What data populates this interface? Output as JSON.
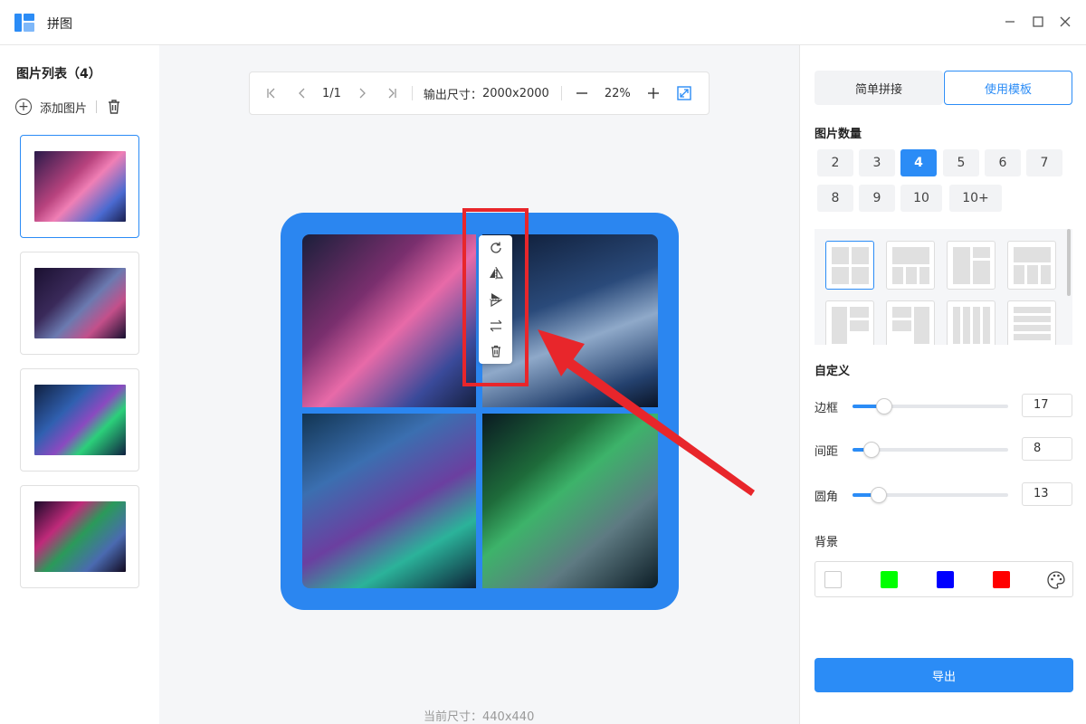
{
  "app": {
    "title": "拼图",
    "logo_icon": "app-logo-icon",
    "window_controls": [
      "minimize-icon",
      "maximize-icon",
      "close-icon"
    ]
  },
  "left_panel": {
    "title": "图片列表（4）",
    "add_label": "添加图片",
    "thumbnails": [
      {
        "name": "thumbnail-1",
        "selected": true
      },
      {
        "name": "thumbnail-2",
        "selected": false
      },
      {
        "name": "thumbnail-3",
        "selected": false
      },
      {
        "name": "thumbnail-4",
        "selected": false
      }
    ]
  },
  "toolbar": {
    "page": "1/1",
    "output_label": "输出尺寸：",
    "output_size": "2000x2000",
    "zoom": "22%"
  },
  "canvas": {
    "current_size_label": "当前尺寸：",
    "current_size": "440x440",
    "collage_color": "#2b86f0",
    "context_menu": [
      "rotate-icon",
      "flip-horizontal-icon",
      "flip-vertical-icon",
      "swap-icon",
      "delete-icon"
    ],
    "highlight_color": "#e8262b"
  },
  "right_panel": {
    "tabs": [
      {
        "label": "简单拼接",
        "active": false
      },
      {
        "label": "使用模板",
        "active": true
      }
    ],
    "count_title": "图片数量",
    "counts": [
      "2",
      "3",
      "4",
      "5",
      "6",
      "7",
      "8",
      "9",
      "10",
      "10+"
    ],
    "selected_count": "4",
    "custom_title": "自定义",
    "sliders": [
      {
        "label": "边框",
        "value": "17",
        "fraction": 0.17
      },
      {
        "label": "间距",
        "value": "8",
        "fraction": 0.08
      },
      {
        "label": "圆角",
        "value": "13",
        "fraction": 0.13
      }
    ],
    "background_title": "背景",
    "background_colors": [
      "#ffffff",
      "#00ff00",
      "#0000ff",
      "#ff0000"
    ],
    "export_label": "导出"
  },
  "accent_color": "#2b8cf6"
}
